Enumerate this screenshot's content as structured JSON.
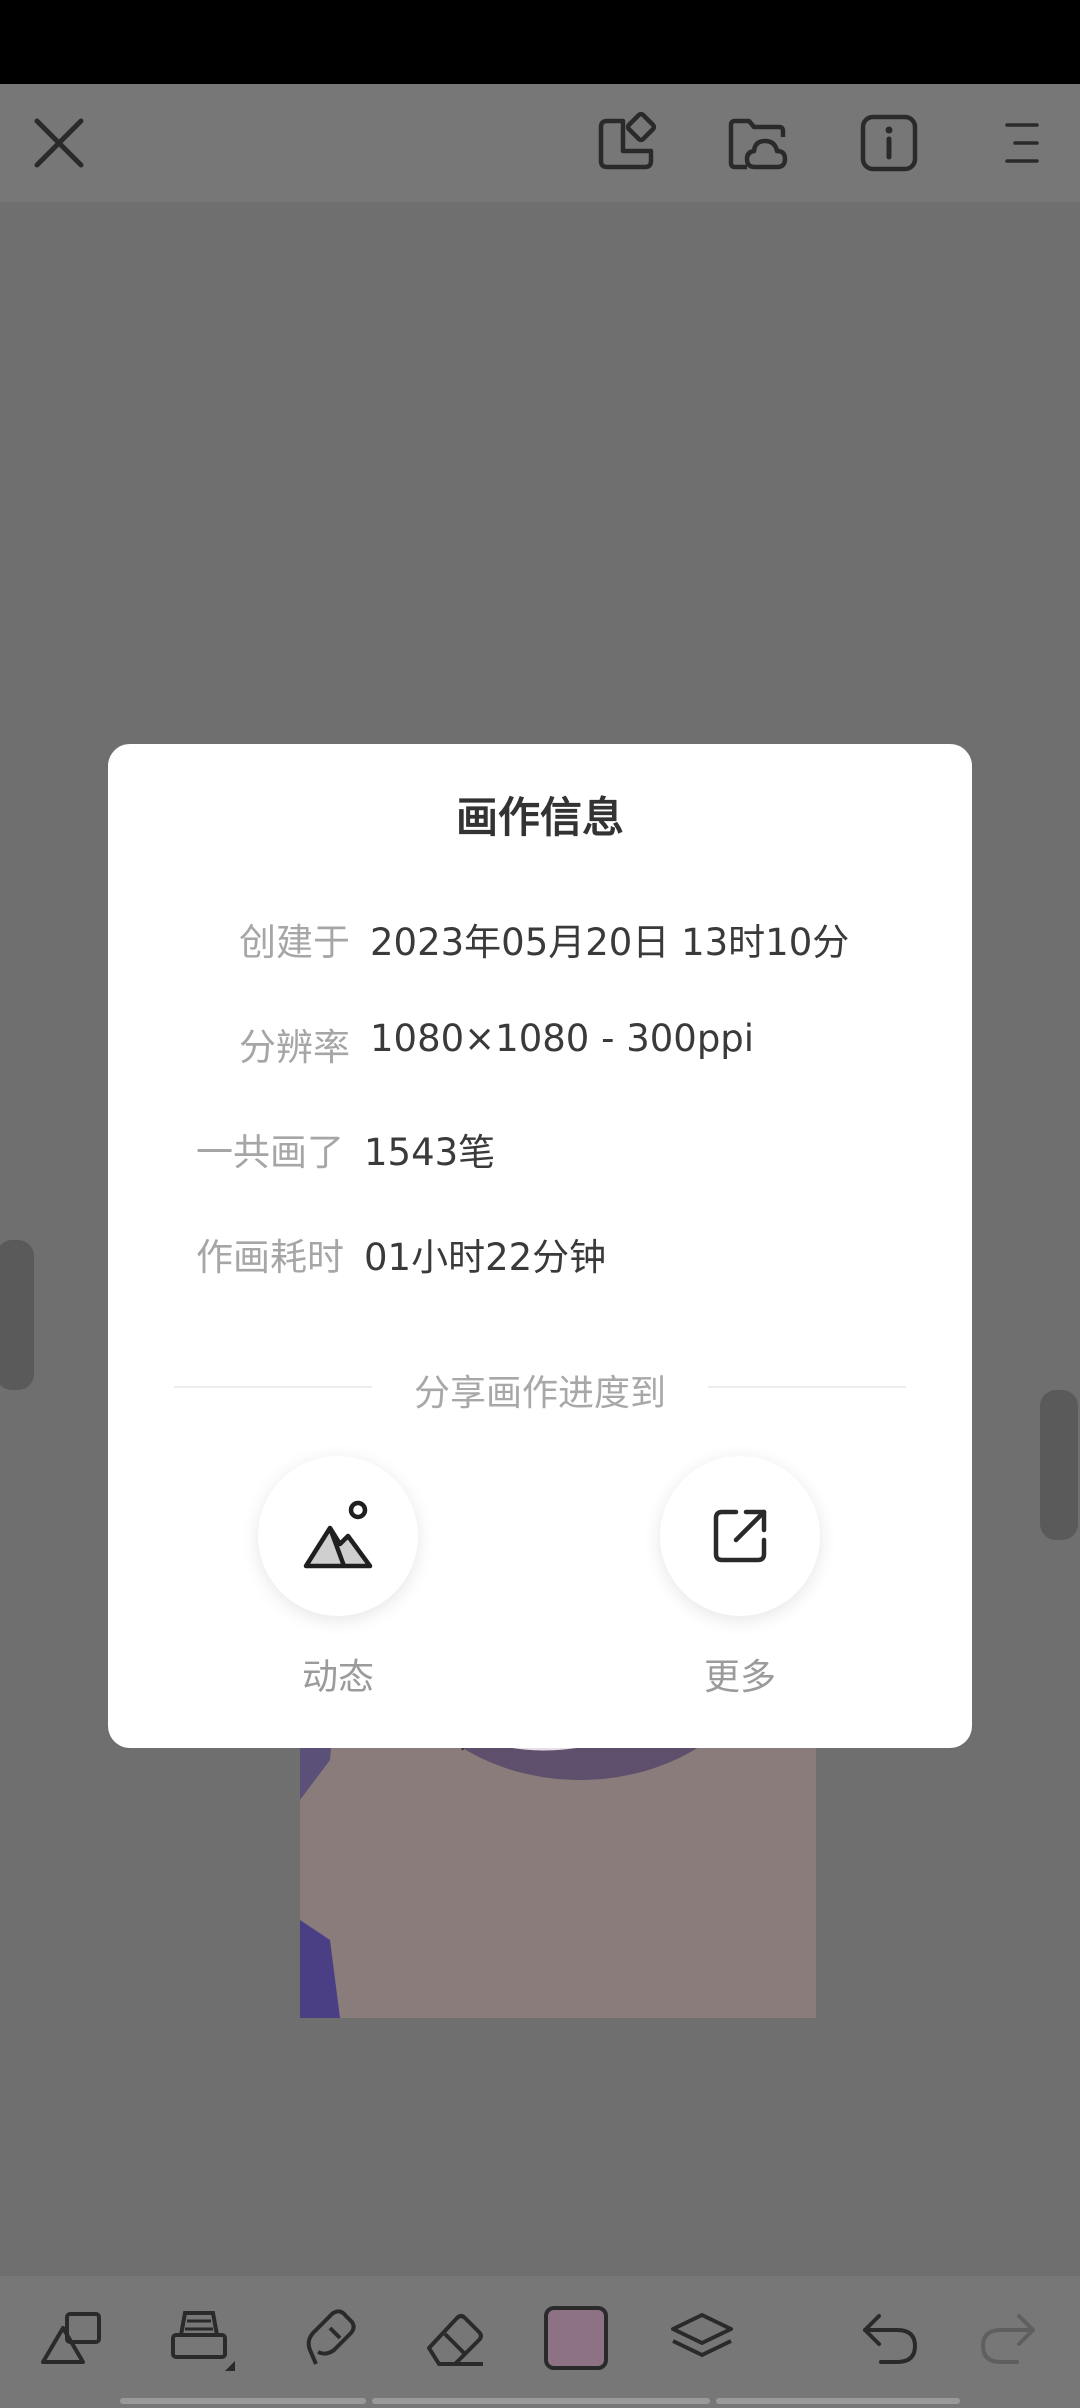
{
  "toolbar": {
    "icons": [
      "close-icon",
      "new-canvas-icon",
      "cloud-folder-icon",
      "info-icon",
      "menu-icon"
    ]
  },
  "dialog": {
    "title": "画作信息",
    "rows": [
      {
        "label": "创建于",
        "value": "2023年05月20日 13时10分"
      },
      {
        "label": "分辨率",
        "value": "1080×1080 - 300ppi"
      },
      {
        "label": "一共画了",
        "value": "1543笔"
      },
      {
        "label": "作画耗时",
        "value": "01小时22分钟"
      }
    ],
    "share_title": "分享画作进度到",
    "share_options": [
      {
        "label": "动态",
        "icon": "mountain-image-icon"
      },
      {
        "label": "更多",
        "icon": "external-share-icon"
      }
    ]
  },
  "bottom_toolbar": {
    "icons": [
      "shapes-icon",
      "stamp-brush-icon",
      "smudge-icon",
      "eraser-icon",
      "color-swatch",
      "layers-icon",
      "undo-icon",
      "redo-icon"
    ],
    "current_color": "#8d7284"
  },
  "colors": {
    "overlay_bg": "#6f6f6f",
    "bars": "#777777",
    "dialog_bg": "#ffffff",
    "label_text": "#a6a6a6",
    "value_text": "#3a3a3a"
  }
}
